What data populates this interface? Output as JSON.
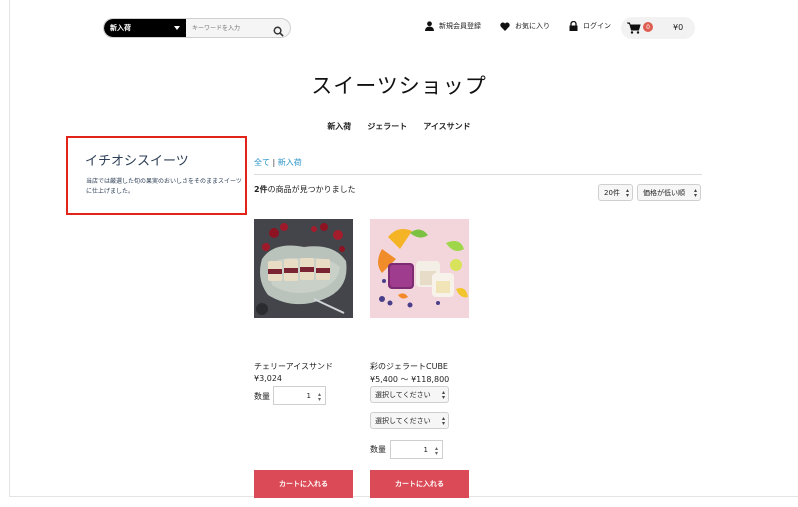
{
  "header": {
    "category_select": "新入荷",
    "search_placeholder": "キーワードを入力",
    "register": "新規会員登録",
    "favorites": "お気に入り",
    "login": "ログイン",
    "cart_count": "0",
    "cart_total": "¥0"
  },
  "shop_title": "スイーツショップ",
  "nav": [
    "新入荷",
    "ジェラート",
    "アイスサンド"
  ],
  "sidebar": {
    "title": "イチオシスイーツ",
    "text": "当店では厳選した旬の果実のおいしさをそのままスイーツに仕上げました。"
  },
  "main": {
    "breadcrumb_all": "全て",
    "breadcrumb_sep": "|",
    "breadcrumb_current": "新入荷",
    "result_count": "2件",
    "result_text": "の商品が見つかりました",
    "per_page": "20件",
    "sort": "価格が低い順"
  },
  "products": [
    {
      "name": "チェリーアイスサンド",
      "price": "¥3,024",
      "qty_label": "数量",
      "qty": "1",
      "cart_label": "カートに入れる"
    },
    {
      "name": "彩のジェラートCUBE",
      "price": "¥5,400 ～ ¥118,800",
      "option1": "選択してください",
      "option2": "選択してください",
      "qty_label": "数量",
      "qty": "1",
      "cart_label": "カートに入れる"
    }
  ],
  "colors": {
    "accent_blue": "#2a94c8",
    "cart_button": "#db4a57",
    "highlight_border": "#e2231a",
    "badge": "#de5d50"
  }
}
